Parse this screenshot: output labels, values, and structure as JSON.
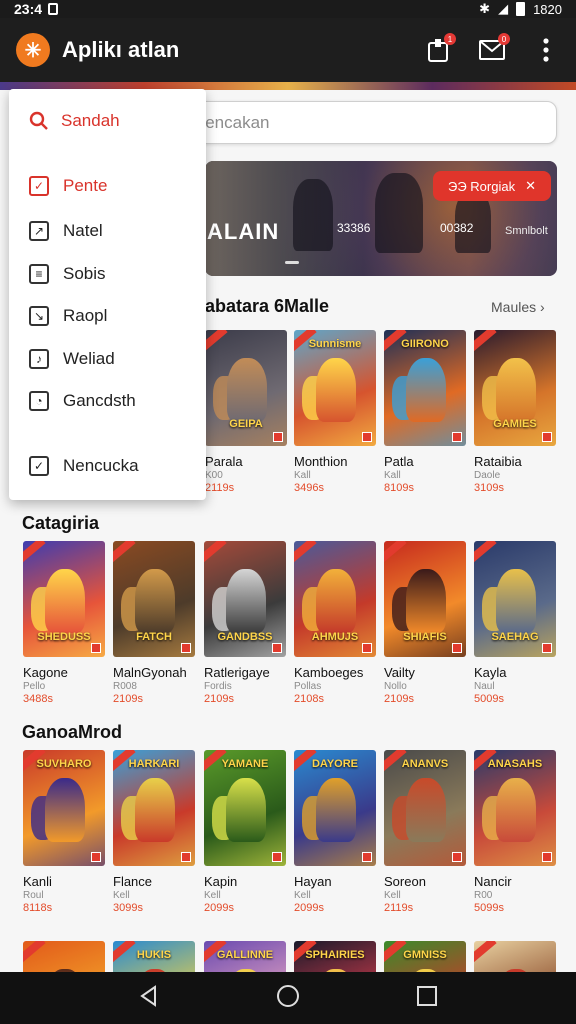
{
  "status_bar": {
    "time": "23:4",
    "right_text": "1820"
  },
  "app_bar": {
    "title": "Aplikı atlan",
    "notif_badge_1": "1",
    "notif_badge_2": "0"
  },
  "search": {
    "placeholder": "Gencakan"
  },
  "hero": {
    "title": "ALAIN",
    "meta_1": "33386",
    "meta_2": "00382",
    "meta_3": "Smnlbolt",
    "cta": "ЭЭ Rorgiak"
  },
  "sections": [
    {
      "title": "abatara 6Malle",
      "more": "Maules",
      "tiles": [
        {
          "cover_text": "GEIPA",
          "name": "Parala",
          "sub": "K00",
          "price": "2119s",
          "colors": [
            "#3c3c4a",
            "#6f6a72",
            "#c28c57"
          ]
        },
        {
          "cover_text": "Sunnisme",
          "name": "Monthion",
          "sub": "Kall",
          "price": "3496s",
          "colors": [
            "#5fa6c9",
            "#d6542e",
            "#ffd54a"
          ]
        },
        {
          "cover_text": "GIIRONO",
          "name": "Patla",
          "sub": "Kall",
          "price": "8109s",
          "colors": [
            "#1e2f57",
            "#e06a24",
            "#3aa0d8"
          ]
        },
        {
          "cover_text": "GAMIES",
          "name": "Rataibia",
          "sub": "Daole",
          "price": "3109s",
          "colors": [
            "#2a1a2e",
            "#d5742a",
            "#f2c14a"
          ]
        }
      ]
    },
    {
      "title": "Catagiria",
      "more": "",
      "tiles": [
        {
          "cover_text": "SHEDUSS",
          "name": "Kagone",
          "sub": "Pello",
          "price": "3488s",
          "colors": [
            "#3e3cb0",
            "#e6543a",
            "#ffd54a"
          ]
        },
        {
          "cover_text": "FATCH",
          "name": "MalnGyonah",
          "sub": "R008",
          "price": "2109s",
          "colors": [
            "#8a4a22",
            "#4d3b2a",
            "#d29a4a"
          ]
        },
        {
          "cover_text": "GANDBSS",
          "name": "Ratlerigaye",
          "sub": "Fordis",
          "price": "2109s",
          "colors": [
            "#a44a3a",
            "#3b3b3b",
            "#d5d5d5"
          ]
        },
        {
          "cover_text": "AHMUJS",
          "name": "Kamboeges",
          "sub": "Pollas",
          "price": "2108s",
          "colors": [
            "#4a5a9a",
            "#c43a2a",
            "#f2b03a"
          ]
        },
        {
          "cover_text": "SHIAFIS",
          "name": "Vailty",
          "sub": "Nollo",
          "price": "2109s",
          "colors": [
            "#c62a1e",
            "#f28a2a",
            "#3a1a1a"
          ]
        },
        {
          "cover_text": "SAEHAG",
          "name": "Kayla",
          "sub": "Naul",
          "price": "5009s",
          "colors": [
            "#2a3a6a",
            "#5a6a8a",
            "#e8c04a"
          ]
        }
      ]
    },
    {
      "title": "GanoaMrod",
      "more": "",
      "tiles": [
        {
          "cover_text": "SUVHARO",
          "name": "Kanli",
          "sub": "Roul",
          "price": "8118s",
          "colors": [
            "#c93a2a",
            "#f29a2a",
            "#3a2a8a"
          ]
        },
        {
          "cover_text": "HARKARI",
          "name": "Flance",
          "sub": "Kell",
          "price": "3099s",
          "colors": [
            "#3aa0d8",
            "#c93a2a",
            "#e8d04a"
          ]
        },
        {
          "cover_text": "YAMANE",
          "name": "Kapin",
          "sub": "Kell",
          "price": "2099s",
          "colors": [
            "#5a9a2a",
            "#2a5a1a",
            "#d8e04a"
          ]
        },
        {
          "cover_text": "DAYORE",
          "name": "Hayan",
          "sub": "Kell",
          "price": "2099s",
          "colors": [
            "#2a8ad0",
            "#3a3a8a",
            "#e0a02a"
          ]
        },
        {
          "cover_text": "ANANVS",
          "name": "Soreon",
          "sub": "Kell",
          "price": "2119s",
          "colors": [
            "#4a4a4a",
            "#8a7a5a",
            "#c84a2a"
          ]
        },
        {
          "cover_text": "ANASAHS",
          "name": "Nancir",
          "sub": "R00",
          "price": "5099s",
          "colors": [
            "#2a3a6a",
            "#c84a3a",
            "#e8b04a"
          ]
        }
      ]
    },
    {
      "title": "",
      "more": "",
      "tiles": [
        {
          "cover_text": "",
          "colors": [
            "#e25a1a",
            "#f2a22a",
            "#5a2a1a"
          ]
        },
        {
          "cover_text": "HUKIS",
          "colors": [
            "#2a8ad0",
            "#e8d04a",
            "#c93a2a"
          ]
        },
        {
          "cover_text": "GALLINNE",
          "colors": [
            "#6a4ab0",
            "#e0a0c0",
            "#f2d04a"
          ]
        },
        {
          "cover_text": "SPHAIRIES",
          "colors": [
            "#1a1a2a",
            "#c93a4a",
            "#f2c14a"
          ]
        },
        {
          "cover_text": "GMNISS",
          "colors": [
            "#3a8a2a",
            "#c93a2a",
            "#f2d04a"
          ]
        },
        {
          "cover_text": "",
          "colors": [
            "#e8d0a0",
            "#8a4a2a",
            "#c93a2a"
          ]
        }
      ]
    }
  ],
  "drawer": {
    "header": "Sandah",
    "items": [
      {
        "label": "Pente",
        "active": true
      },
      {
        "label": "Natel",
        "active": false
      },
      {
        "label": "Sobis",
        "active": false
      },
      {
        "label": "Raopl",
        "active": false
      },
      {
        "label": "Weliad",
        "active": false
      },
      {
        "label": "Gancdsth",
        "active": false
      },
      {
        "label": "Nencucka",
        "active": false
      }
    ]
  },
  "nav": {
    "back": "back-icon",
    "home": "home-icon",
    "recents": "recents-icon"
  },
  "colors": {
    "accent": "#e0352b",
    "appbar": "#1e1e1e",
    "price": "#e34c2b"
  }
}
